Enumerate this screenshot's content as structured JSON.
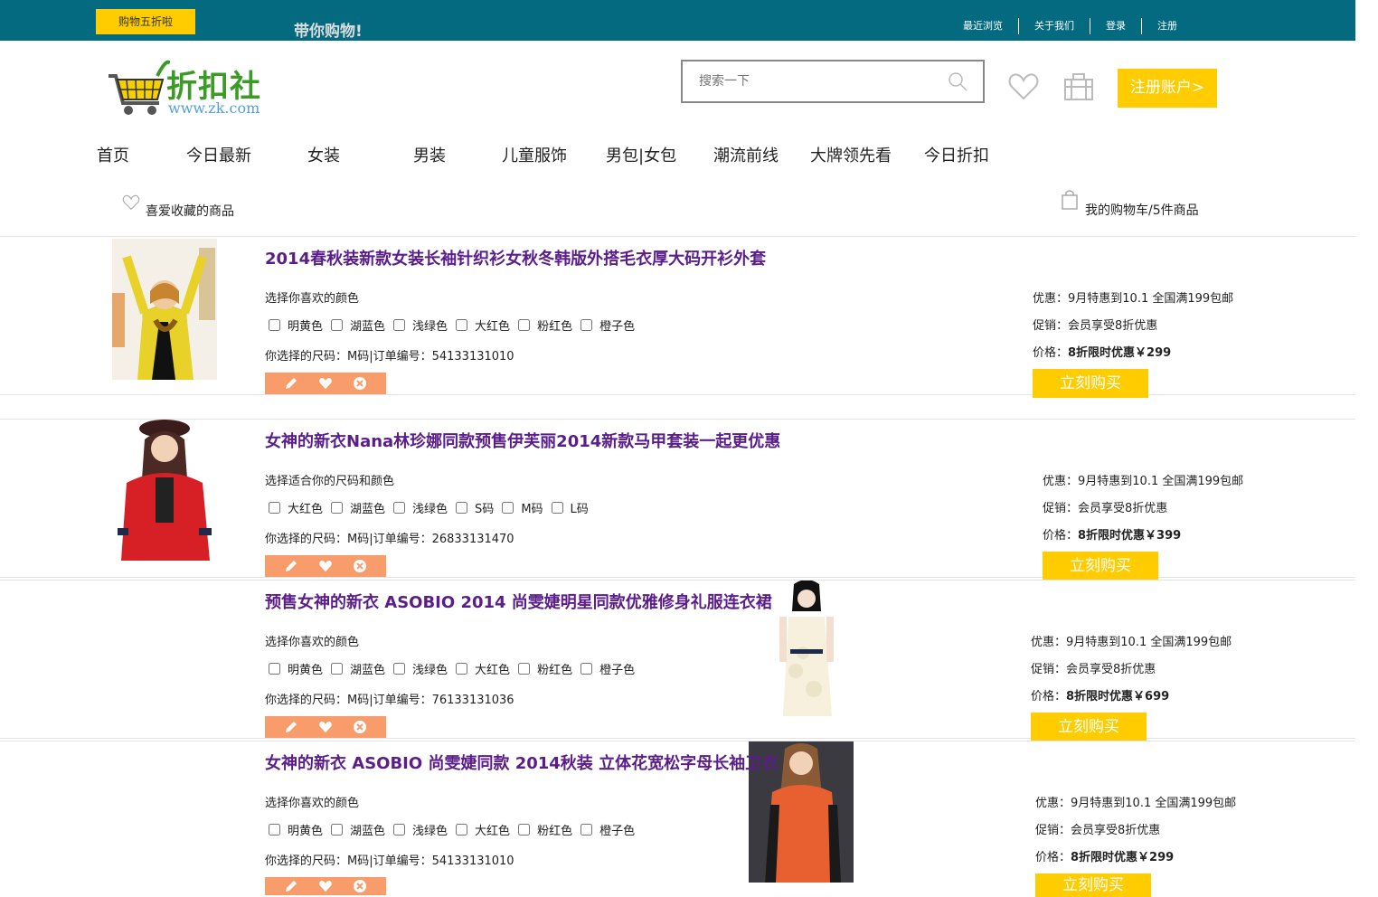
{
  "topbar": {
    "promo": "购物五折啦",
    "slogan": "带你购物!",
    "links": [
      "最近浏览",
      "关于我们",
      "登录",
      "注册"
    ]
  },
  "logo": {
    "text": "折扣社",
    "url": "www.zk.com"
  },
  "search": {
    "placeholder": "搜索一下"
  },
  "register_label": "注册账户>",
  "nav": [
    "首页",
    "今日最新",
    "女装",
    "男装",
    "儿童服饰",
    "男包|女包",
    "潮流前线",
    "大牌领先看",
    "今日折扣"
  ],
  "favorites_label": "喜爱收藏的商品",
  "cart_label": "我的购物车/5件商品",
  "buy_label": "立刻购买",
  "items": [
    {
      "title": "2014春秋装新款女装长袖针织衫女秋冬韩版外搭毛衣厚大码开衫外套",
      "choose": "选择你喜欢的颜色",
      "options": [
        "明黄色",
        "湖蓝色",
        "浅绿色",
        "大红色",
        "粉红色",
        "橙子色"
      ],
      "selection": "你选择的尺码：M码|订单编号：54133131010",
      "promo1": "优惠：9月特惠到10.1 全国满199包邮",
      "promo2": "促销：会员享受8折优惠",
      "price_prefix": "价格：",
      "price": "8折限时优惠￥299"
    },
    {
      "title": "女神的新衣Nana林珍娜同款预售伊芙丽2014新款马甲套装一起更优惠",
      "choose": "选择适合你的尺码和颜色",
      "options": [
        "大红色",
        "湖蓝色",
        "浅绿色",
        "S码",
        "M码",
        "L码"
      ],
      "selection": "你选择的尺码：M码|订单编号：26833131470",
      "promo1": "优惠：9月特惠到10.1 全国满199包邮",
      "promo2": "促销：会员享受8折优惠",
      "price_prefix": "价格：",
      "price": "8折限时优惠￥399"
    },
    {
      "title": "预售女神的新衣 ASOBIO 2014 尚雯婕明星同款优雅修身礼服连衣裙",
      "choose": "选择你喜欢的颜色",
      "options": [
        "明黄色",
        "湖蓝色",
        "浅绿色",
        "大红色",
        "粉红色",
        "橙子色"
      ],
      "selection": "你选择的尺码：M码|订单编号：76133131036",
      "promo1": "优惠：9月特惠到10.1 全国满199包邮",
      "promo2": "促销：会员享受8折优惠",
      "price_prefix": "价格：",
      "price": "8折限时优惠￥699"
    },
    {
      "title": "女神的新衣 ASOBIO 尚雯婕同款 2014秋装 立体花宽松字母长袖卫衣",
      "choose": "选择你喜欢的颜色",
      "options": [
        "明黄色",
        "湖蓝色",
        "浅绿色",
        "大红色",
        "粉红色",
        "橙子色"
      ],
      "selection": "你选择的尺码：M码|订单编号：54133131010",
      "promo1": "优惠：9月特惠到10.1 全国满199包邮",
      "promo2": "促销：会员享受8折优惠",
      "price_prefix": "价格：",
      "price": "8折限时优惠￥299"
    }
  ]
}
